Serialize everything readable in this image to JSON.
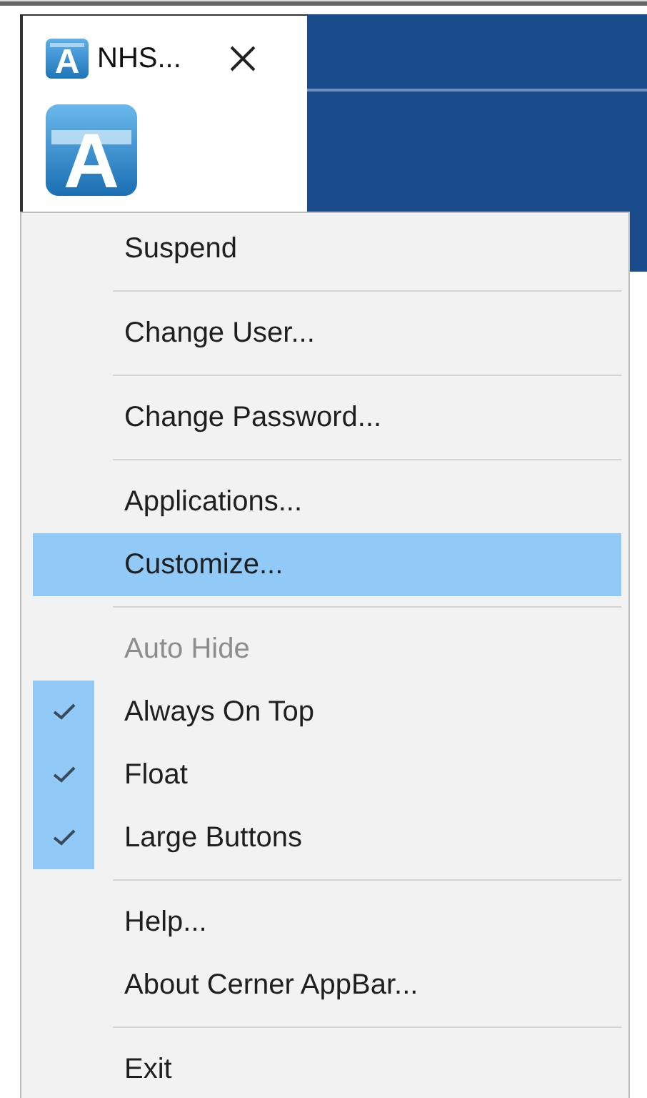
{
  "window": {
    "tab_icon_letter": "A",
    "title": "NHS...",
    "logo_letter": "A"
  },
  "menu": {
    "groups": [
      [
        {
          "label": "Suspend",
          "selected": false,
          "disabled": false
        }
      ],
      [
        {
          "label": "Change User...",
          "selected": false,
          "disabled": false
        }
      ],
      [
        {
          "label": "Change Password...",
          "selected": false,
          "disabled": false
        }
      ],
      [
        {
          "label": "Applications...",
          "selected": false,
          "disabled": false
        },
        {
          "label": "Customize...",
          "selected": true,
          "disabled": false
        }
      ],
      [
        {
          "label": "Auto Hide",
          "selected": false,
          "disabled": true,
          "checked": false
        },
        {
          "label": "Always On Top",
          "selected": false,
          "disabled": false,
          "checked": true
        },
        {
          "label": "Float",
          "selected": false,
          "disabled": false,
          "checked": true
        },
        {
          "label": "Large Buttons",
          "selected": false,
          "disabled": false,
          "checked": true
        }
      ],
      [
        {
          "label": "Help...",
          "selected": false,
          "disabled": false
        },
        {
          "label": "About Cerner AppBar...",
          "selected": false,
          "disabled": false
        }
      ],
      [
        {
          "label": "Exit",
          "selected": false,
          "disabled": false
        }
      ]
    ]
  }
}
